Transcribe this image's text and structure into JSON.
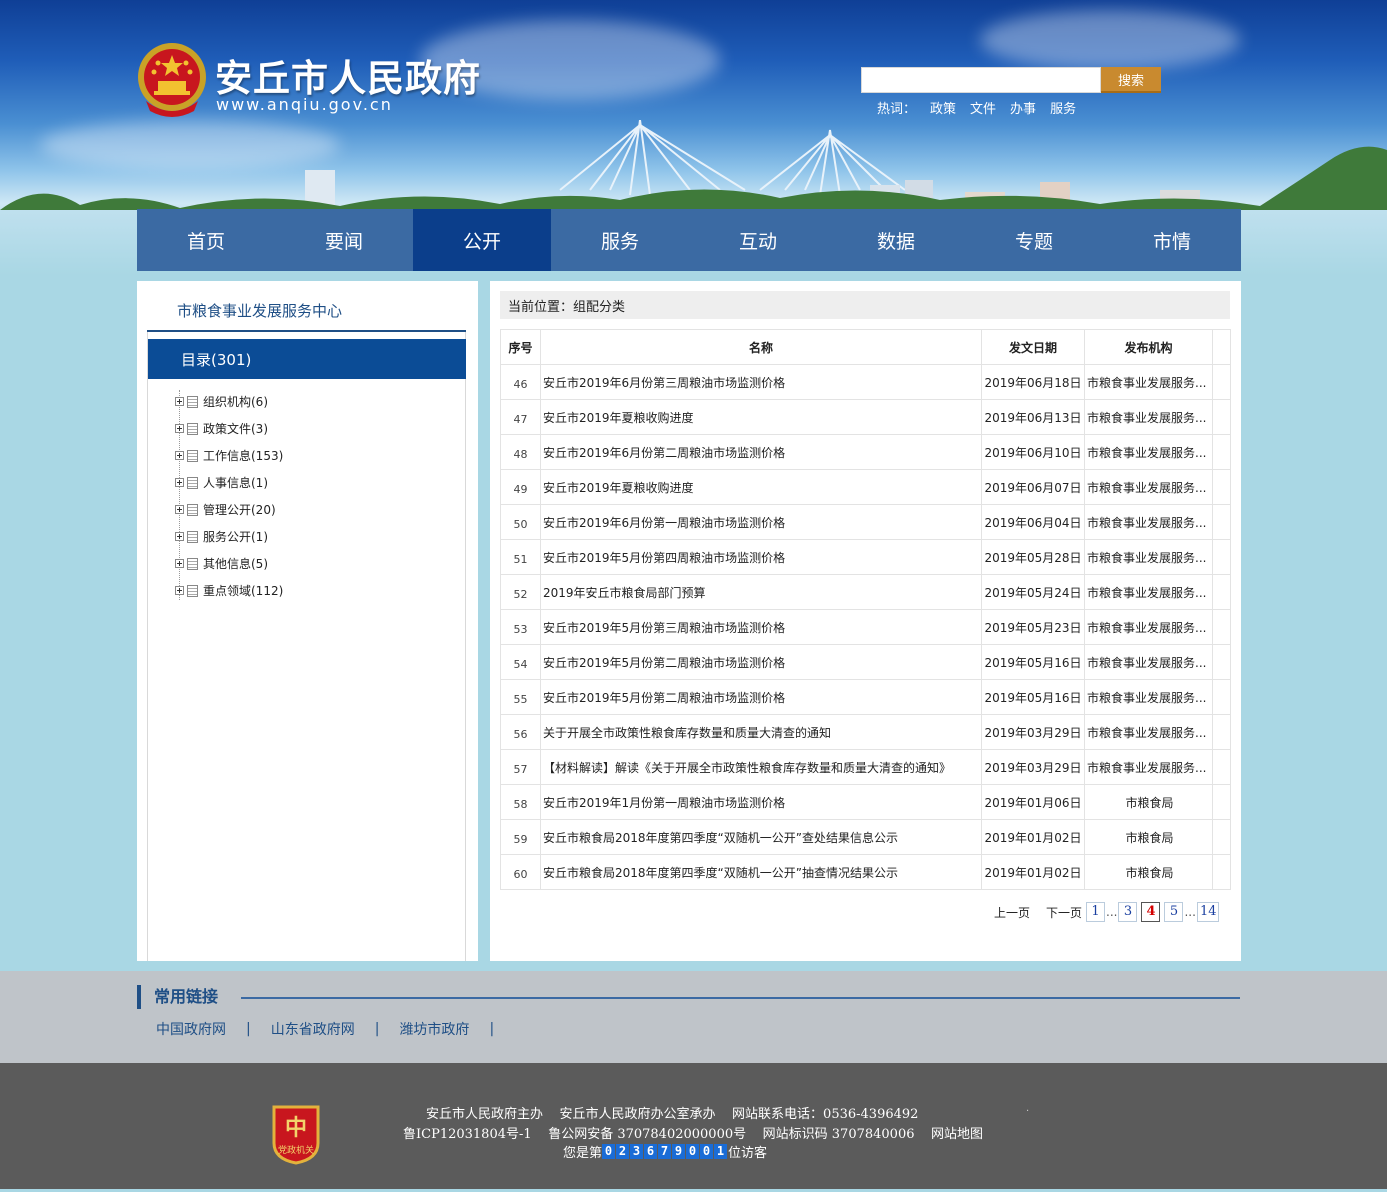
{
  "header": {
    "site_title": "安丘市人民政府",
    "site_url": "www.anqiu.gov.cn",
    "search": {
      "placeholder": "",
      "button_label": "搜索"
    },
    "hot_words": {
      "label": "热词：",
      "items": [
        "政策",
        "文件",
        "办事",
        "服务"
      ]
    }
  },
  "nav": {
    "items": [
      "首页",
      "要闻",
      "公开",
      "服务",
      "互动",
      "数据",
      "专题",
      "市情"
    ],
    "active_index": 2
  },
  "sidebar": {
    "org_name": "市粮食事业发展服务中心",
    "catalog_label": "目录(301)",
    "tree": [
      {
        "label": "组织机构(6)"
      },
      {
        "label": "政策文件(3)"
      },
      {
        "label": "工作信息(153)"
      },
      {
        "label": "人事信息(1)"
      },
      {
        "label": "管理公开(20)"
      },
      {
        "label": "服务公开(1)"
      },
      {
        "label": "其他信息(5)"
      },
      {
        "label": "重点领域(112)"
      }
    ]
  },
  "main": {
    "location": "当前位置：组配分类",
    "table": {
      "headers": {
        "seq": "序号",
        "name": "名称",
        "date": "发文日期",
        "org": "发布机构"
      },
      "rows": [
        {
          "seq": "46",
          "name": "安丘市2019年6月份第三周粮油市场监测价格",
          "date": "2019年06月18日",
          "org": "市粮食事业发展服务..."
        },
        {
          "seq": "47",
          "name": "安丘市2019年夏粮收购进度",
          "date": "2019年06月13日",
          "org": "市粮食事业发展服务..."
        },
        {
          "seq": "48",
          "name": "安丘市2019年6月份第二周粮油市场监测价格",
          "date": "2019年06月10日",
          "org": "市粮食事业发展服务..."
        },
        {
          "seq": "49",
          "name": "安丘市2019年夏粮收购进度",
          "date": "2019年06月07日",
          "org": "市粮食事业发展服务..."
        },
        {
          "seq": "50",
          "name": "安丘市2019年6月份第一周粮油市场监测价格",
          "date": "2019年06月04日",
          "org": "市粮食事业发展服务..."
        },
        {
          "seq": "51",
          "name": "安丘市2019年5月份第四周粮油市场监测价格",
          "date": "2019年05月28日",
          "org": "市粮食事业发展服务..."
        },
        {
          "seq": "52",
          "name": "2019年安丘市粮食局部门预算",
          "date": "2019年05月24日",
          "org": "市粮食事业发展服务..."
        },
        {
          "seq": "53",
          "name": "安丘市2019年5月份第三周粮油市场监测价格",
          "date": "2019年05月23日",
          "org": "市粮食事业发展服务..."
        },
        {
          "seq": "54",
          "name": "安丘市2019年5月份第二周粮油市场监测价格",
          "date": "2019年05月16日",
          "org": "市粮食事业发展服务..."
        },
        {
          "seq": "55",
          "name": "安丘市2019年5月份第二周粮油市场监测价格",
          "date": "2019年05月16日",
          "org": "市粮食事业发展服务..."
        },
        {
          "seq": "56",
          "name": "关于开展全市政策性粮食库存数量和质量大清查的通知",
          "date": "2019年03月29日",
          "org": "市粮食事业发展服务..."
        },
        {
          "seq": "57",
          "name": "【材料解读】解读《关于开展全市政策性粮食库存数量和质量大清查的通知》",
          "date": "2019年03月29日",
          "org": "市粮食事业发展服务..."
        },
        {
          "seq": "58",
          "name": "安丘市2019年1月份第一周粮油市场监测价格",
          "date": "2019年01月06日",
          "org": "市粮食局"
        },
        {
          "seq": "59",
          "name": "安丘市粮食局2018年度第四季度“双随机一公开”查处结果信息公示",
          "date": "2019年01月02日",
          "org": "市粮食局"
        },
        {
          "seq": "60",
          "name": "安丘市粮食局2018年度第四季度“双随机一公开”抽查情况结果公示",
          "date": "2019年01月02日",
          "org": "市粮食局"
        }
      ]
    },
    "pager": {
      "prev": "上一页",
      "next": "下一页",
      "pages": [
        "1",
        "...",
        "3",
        "4",
        "5",
        "...",
        "14"
      ],
      "current": "4"
    }
  },
  "links": {
    "title": "常用链接",
    "items": [
      "中国政府网",
      "山东省政府网",
      "潍坊市政府"
    ],
    "separator": "|"
  },
  "footer": {
    "line1": "安丘市人民政府主办    安丘市人民政府办公室承办    网站联系电话：0536-4396492",
    "line2": "鲁ICP12031804号-1    鲁公网安备 37078402000000号    网站标识码 3707840006    网站地图",
    "visitor_prefix": "您是第",
    "visitor_digits": [
      "0",
      "2",
      "3",
      "6",
      "7",
      "9",
      "0",
      "0",
      "1"
    ],
    "visitor_suffix": "位访客",
    "badge_text": "党政机关",
    "dot": "."
  },
  "colors": {
    "nav_bg": "#3b6aa3",
    "nav_active": "#0b3e8b",
    "catalog_bg": "#0b4c96",
    "search_button": "#c98a2f",
    "footer_bg": "#5b5b5b",
    "page_current": "#d40000"
  }
}
